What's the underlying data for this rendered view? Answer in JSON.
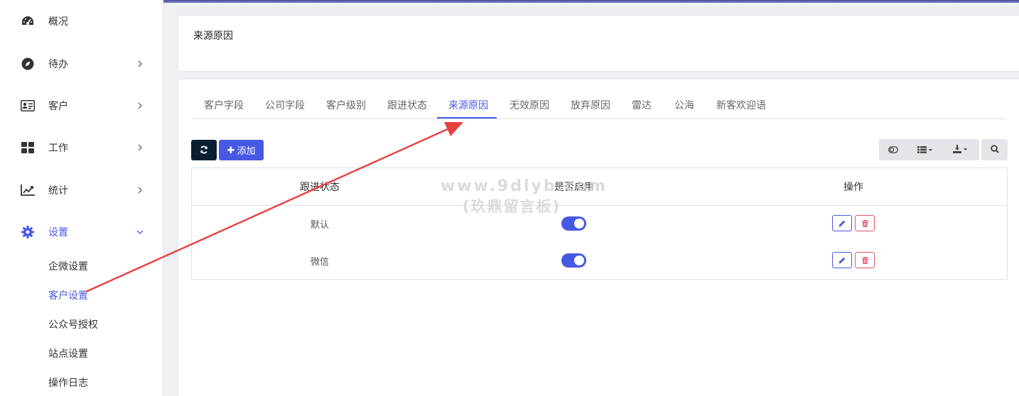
{
  "sidebar": {
    "items": [
      {
        "label": "概况",
        "icon": "dashboard-icon",
        "has_chevron": false
      },
      {
        "label": "待办",
        "icon": "compass-icon",
        "has_chevron": true
      },
      {
        "label": "客户",
        "icon": "id-card-icon",
        "has_chevron": true
      },
      {
        "label": "工作",
        "icon": "grid-icon",
        "has_chevron": true
      },
      {
        "label": "统计",
        "icon": "chart-line-icon",
        "has_chevron": true
      },
      {
        "label": "设置",
        "icon": "gear-icon",
        "has_chevron": true,
        "expanded": true
      }
    ],
    "sub_items": [
      "企微设置",
      "客户设置",
      "公众号授权",
      "站点设置",
      "操作日志"
    ],
    "active_sub": "客户设置"
  },
  "page_title": "来源原因",
  "tabs": [
    "客户字段",
    "公司字段",
    "客户级别",
    "跟进状态",
    "来源原因",
    "无效原因",
    "放弃原因",
    "雷达",
    "公海",
    "新客欢迎语"
  ],
  "active_tab": "来源原因",
  "toolbar": {
    "add_label": "添加",
    "refresh_icon": "refresh-icon",
    "toggle_icon": "toggle-icon",
    "columns_icon": "list-icon",
    "export_icon": "download-icon",
    "search_icon": "search-icon"
  },
  "table": {
    "headers": [
      "跟进状态",
      "是否启用",
      "操作"
    ],
    "rows": [
      {
        "name": "默认",
        "enabled": true
      },
      {
        "name": "微信",
        "enabled": true
      }
    ]
  },
  "watermark": {
    "line1": "www.9dlyb.com",
    "line2": "(玖鼎留言板)"
  },
  "colors": {
    "accent": "#4759e4",
    "danger": "#e4566c",
    "dark": "#0b1f33",
    "annotation_arrow": "#e8403f"
  }
}
